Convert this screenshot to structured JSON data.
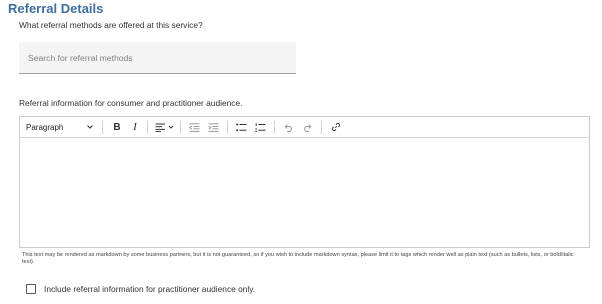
{
  "section": {
    "title": "Referral Details"
  },
  "referral_methods": {
    "question": "What referral methods are offered at this service?",
    "search_placeholder": "Search for referral methods"
  },
  "referral_info": {
    "label": "Referral information for consumer and practitioner audience.",
    "editor": {
      "block_format": "Paragraph",
      "bold": "B",
      "italic": "I",
      "body_text": ""
    },
    "help_text": "This text may be rendered as markdown by some business partners, but it is not guaranteed, so if you wish to include markdown syntax, please limit it to tags which render well as plain text (such as bullets, lists, or bold/italic text)."
  },
  "practitioner_only": {
    "checked": false,
    "label": "Include referral information for practitioner audience only."
  }
}
